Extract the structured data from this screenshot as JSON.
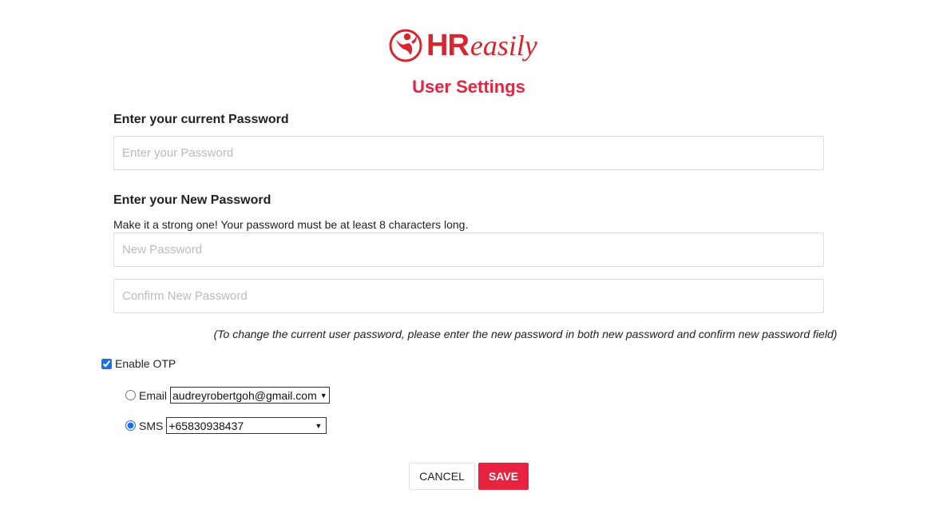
{
  "brand": {
    "logo_part1": "HR",
    "logo_part2": "easily",
    "accent_color": "#e8233f",
    "logo_color": "#d9252f"
  },
  "page": {
    "title": "User Settings"
  },
  "current_password": {
    "heading": "Enter your current Password",
    "placeholder": "Enter your Password",
    "value": ""
  },
  "new_password": {
    "heading": "Enter your New Password",
    "hint": "Make it a strong one! Your password must be at least 8 characters long.",
    "new_placeholder": "New Password",
    "confirm_placeholder": "Confirm New Password",
    "note": "(To change the current user password, please enter the new password in both new password and confirm new password field)"
  },
  "otp": {
    "enable_label": "Enable OTP",
    "enabled": true,
    "email_label": "Email",
    "email_value": "audreyrobertgoh@gmail.com",
    "email_selected": false,
    "sms_label": "SMS",
    "sms_value": "+65830938437",
    "sms_selected": true
  },
  "actions": {
    "cancel_label": "CANCEL",
    "save_label": "SAVE"
  }
}
